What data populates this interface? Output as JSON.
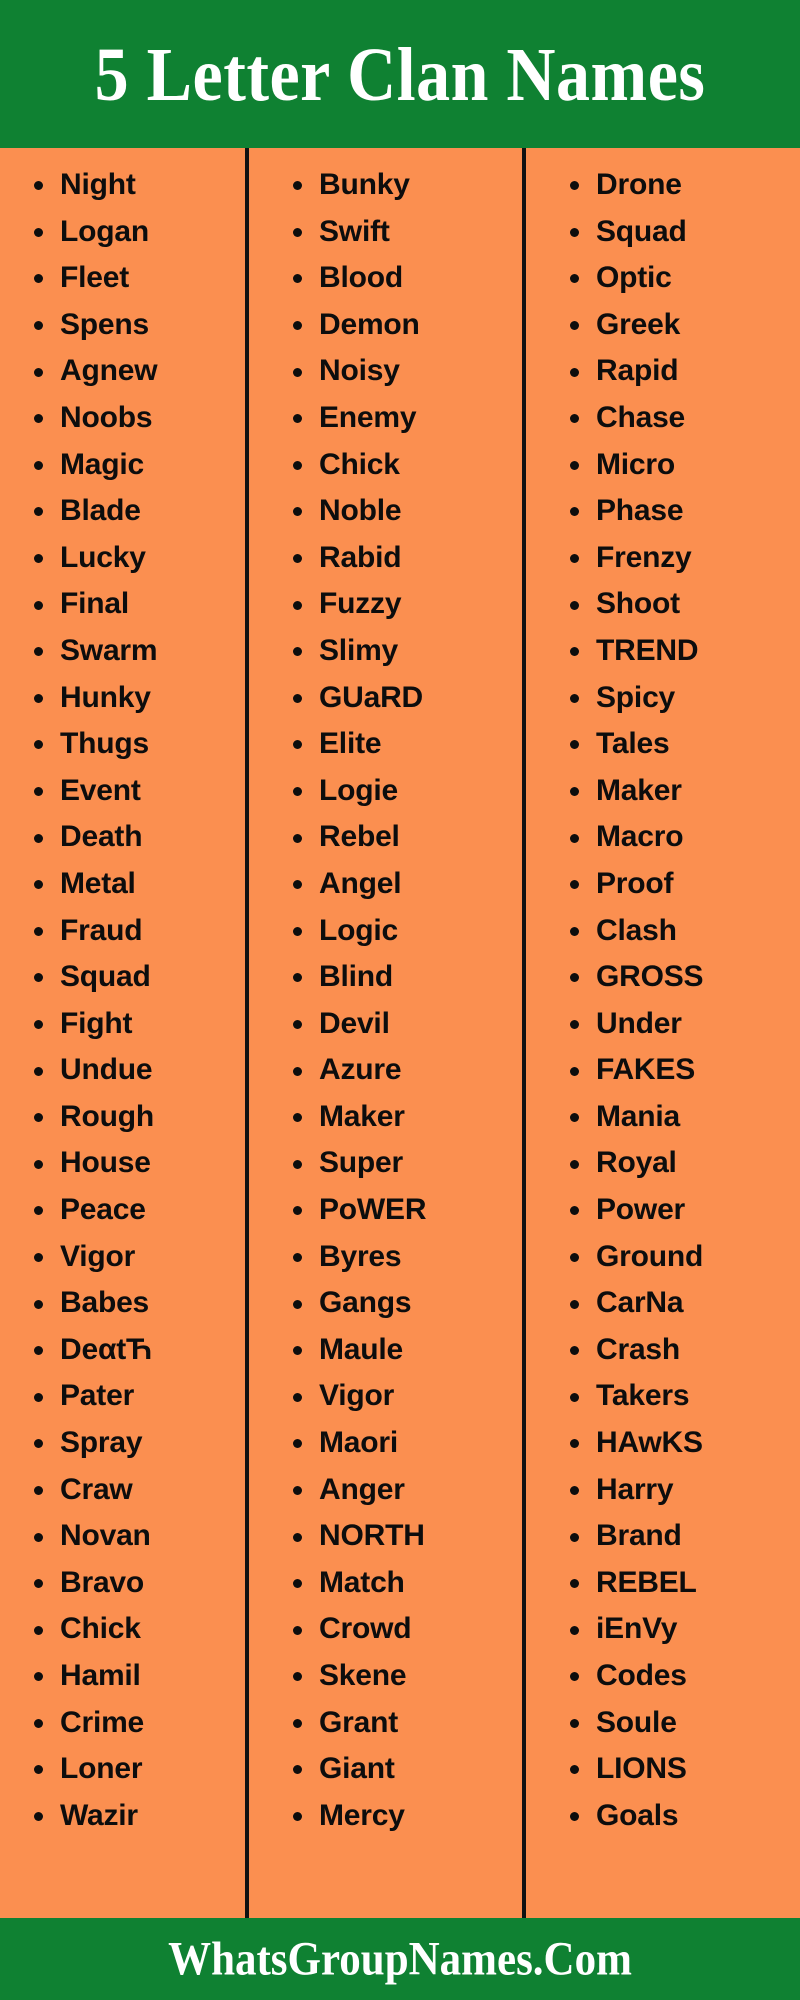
{
  "colors": {
    "banner_green": "#0F8132",
    "body_orange": "#FB8F50",
    "text_black": "#0D0D0D",
    "banner_text_white": "#FFFFFF",
    "divider_black": "#111111"
  },
  "header": {
    "title": "5 Letter Clan Names"
  },
  "footer": {
    "site": "WhatsGroupNames.Com"
  },
  "columns": [
    {
      "id": "column-1",
      "items": [
        "Night",
        "Logan",
        "Fleet",
        "Spens",
        "Agnew",
        "Noobs",
        "Magic",
        "Blade",
        "Lucky",
        "Final",
        "Swarm",
        "Hunky",
        "Thugs",
        "Event",
        "Death",
        "Metal",
        "Fraud",
        "Squad",
        "Fight",
        "Undue",
        "Rough",
        "House",
        "Peace",
        "Vigor",
        "Babes",
        "DeαtЋ",
        "Pater",
        "Spray",
        "Craw",
        "Novan",
        "Bravo",
        "Chick",
        "Hamil",
        "Crime",
        "Loner",
        "Wazir"
      ]
    },
    {
      "id": "column-2",
      "items": [
        "Bunky",
        "Swift",
        "Blood",
        "Demon",
        "Noisy",
        "Enemy",
        "Chick",
        "Noble",
        "Rabid",
        "Fuzzy",
        "Slimy",
        "GUaRD",
        "Elite",
        "Logie",
        "Rebel",
        "Angel",
        "Logic",
        "Blind",
        "Devil",
        "Azure",
        "Maker",
        "Super",
        "PoWER",
        "Byres",
        "Gangs",
        "Maule",
        "Vigor",
        "Maori",
        "Anger",
        "NORTH",
        "Match",
        "Crowd",
        "Skene",
        "Grant",
        "Giant",
        "Mercy"
      ]
    },
    {
      "id": "column-3",
      "items": [
        "Drone",
        "Squad",
        "Optic",
        "Greek",
        "Rapid",
        "Chase",
        "Micro",
        "Phase",
        "Frenzy",
        "Shoot",
        "TREND",
        "Spicy",
        "Tales",
        "Maker",
        "Macro",
        "Proof",
        "Clash",
        "GROSS",
        "Under",
        "FAKES",
        "Mania",
        "Royal",
        "Power",
        "Ground",
        "CarNa",
        "Crash",
        "Takers",
        "HAwKS",
        "Harry",
        "Brand",
        "REBEL",
        "iEnVy",
        "Codes",
        "Soule",
        "LIONS",
        "Goals"
      ]
    }
  ]
}
